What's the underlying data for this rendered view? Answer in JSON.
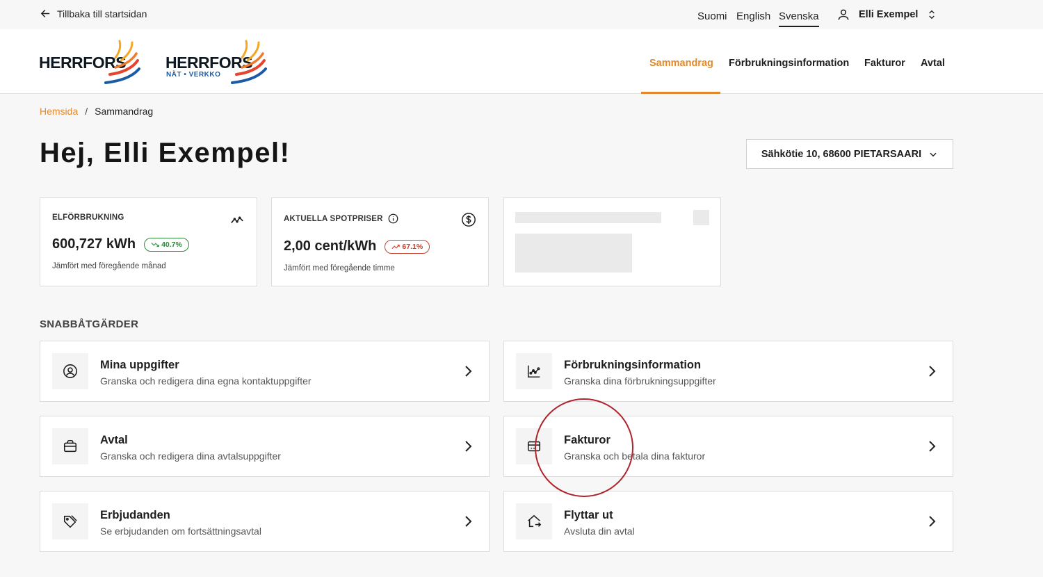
{
  "topbar": {
    "back_label": "Tillbaka till startsidan",
    "languages": [
      "Suomi",
      "English",
      "Svenska"
    ],
    "active_language": "Svenska",
    "user_name": "Elli Exempel"
  },
  "header": {
    "logo1": {
      "text": "HERRFORS"
    },
    "logo2": {
      "text": "HERRFORS",
      "sub": "NÄT • VERKKO"
    },
    "nav": [
      {
        "label": "Sammandrag",
        "active": true
      },
      {
        "label": "Förbrukningsinformation",
        "active": false
      },
      {
        "label": "Fakturor",
        "active": false
      },
      {
        "label": "Avtal",
        "active": false
      }
    ],
    "accent_color": "#e08a2c"
  },
  "breadcrumb": {
    "home": "Hemsida",
    "separator": "/",
    "current": "Sammandrag"
  },
  "greeting": "Hej, Elli Exempel!",
  "address_select": {
    "value": "Sähkötie 10, 68600 PIETARSAARI"
  },
  "stats": [
    {
      "title": "ELFÖRBRUKNING",
      "icon": "trend-line-icon",
      "value": "600,727 kWh",
      "change": "40.7%",
      "direction": "down",
      "note": "Jämfört med föregående månad"
    },
    {
      "title": "AKTUELLA SPOTPRISER",
      "info_icon": "info-icon",
      "icon": "dollar-circle-icon",
      "value": "2,00 cent/kWh",
      "change": "67.1%",
      "direction": "up",
      "note": "Jämfört med föregående timme"
    }
  ],
  "quick_actions": {
    "title": "SNABBÅTGÄRDER",
    "items": [
      {
        "icon": "user-circle-icon",
        "title": "Mina uppgifter",
        "subtitle": "Granska och redigera dina egna kontaktuppgifter"
      },
      {
        "icon": "chart-icon",
        "title": "Förbrukningsinformation",
        "subtitle": "Granska dina förbrukningsuppgifter"
      },
      {
        "icon": "briefcase-icon",
        "title": "Avtal",
        "subtitle": "Granska och redigera dina avtalsuppgifter"
      },
      {
        "icon": "card-icon",
        "title": "Fakturor",
        "subtitle": "Granska och betala dina fakturor"
      },
      {
        "icon": "tag-icon",
        "title": "Erbjudanden",
        "subtitle": "Se erbjudanden om fortsättningsavtal"
      },
      {
        "icon": "house-move-icon",
        "title": "Flyttar ut",
        "subtitle": "Avsluta din avtal"
      }
    ]
  }
}
